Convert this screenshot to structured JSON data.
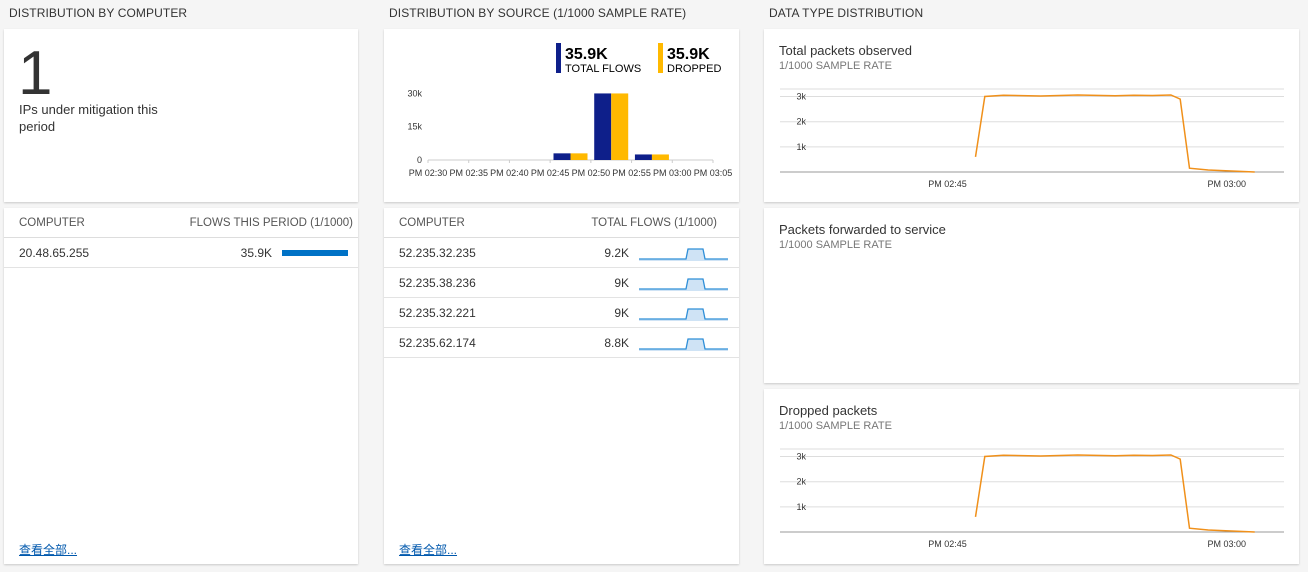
{
  "sections": {
    "computer": "DISTRIBUTION BY COMPUTER",
    "source": "DISTRIBUTION BY SOURCE (1/1000 SAMPLE RATE)",
    "datatype": "DATA TYPE DISTRIBUTION"
  },
  "mitigation": {
    "count": "1",
    "caption": "IPs under mitigation this period"
  },
  "computer_table": {
    "col1": "COMPUTER",
    "col2": "FLOWS THIS PERIOD (1/1000)",
    "rows": [
      {
        "ip": "20.48.65.255",
        "flows": "35.9K",
        "fraction": 1.0
      }
    ],
    "see_all": "查看全部..."
  },
  "source_chart": {
    "legend": [
      {
        "value": "35.9K",
        "label": "TOTAL FLOWS",
        "color": "#0e1f8a"
      },
      {
        "value": "35.9K",
        "label": "DROPPED",
        "color": "#ffb900"
      }
    ]
  },
  "source_table": {
    "col1": "COMPUTER",
    "col2": "TOTAL FLOWS (1/1000)",
    "rows": [
      {
        "ip": "52.235.32.235",
        "flows": "9.2K"
      },
      {
        "ip": "52.235.38.236",
        "flows": "9K"
      },
      {
        "ip": "52.235.32.221",
        "flows": "9K"
      },
      {
        "ip": "52.235.62.174",
        "flows": "8.8K"
      }
    ],
    "see_all": "查看全部..."
  },
  "datatype_tiles": [
    {
      "title": "Total packets observed",
      "subtitle": "1/1000 SAMPLE RATE"
    },
    {
      "title": "Packets forwarded to service",
      "subtitle": "1/1000 SAMPLE RATE"
    },
    {
      "title": "Dropped packets",
      "subtitle": "1/1000 SAMPLE RATE"
    }
  ],
  "chart_data": [
    {
      "type": "bar",
      "categories": [
        "PM 02:30",
        "PM 02:35",
        "PM 02:40",
        "PM 02:45",
        "PM 02:50",
        "PM 02:55",
        "PM 03:00",
        "PM 03:05"
      ],
      "tick_labels": [
        "PM 02:30",
        "PM 02:35",
        "PM 02:40",
        "PM 02:45",
        "PM 02:50",
        "PM 02:55",
        "PM 03:00",
        "PM 03:05"
      ],
      "series": [
        {
          "name": "TOTAL FLOWS",
          "color": "#0e1f8a",
          "values": [
            0,
            0,
            0,
            3000,
            30000,
            2500,
            0,
            0
          ]
        },
        {
          "name": "DROPPED",
          "color": "#ffb900",
          "values": [
            0,
            0,
            0,
            3000,
            30000,
            2500,
            0,
            0
          ]
        }
      ],
      "yticks": [
        "0",
        "15k",
        "30k"
      ],
      "ytick_values": [
        0,
        15000,
        30000
      ],
      "ylim": [
        0,
        32000
      ],
      "legend": "top-right"
    },
    {
      "type": "line",
      "x_minutes": [
        46.5,
        47,
        48,
        50,
        52,
        54,
        55,
        56,
        57,
        57.5,
        58,
        59,
        61.5
      ],
      "values": [
        600,
        3000,
        3050,
        3020,
        3060,
        3030,
        3050,
        3040,
        3060,
        2900,
        150,
        80,
        0
      ],
      "xticks": [
        "PM 02:45",
        "PM 03:00"
      ],
      "xtick_minutes": [
        45,
        60
      ],
      "yticks": [
        "1k",
        "2k",
        "3k"
      ],
      "ytick_values": [
        1000,
        2000,
        3000
      ],
      "ylim": [
        0,
        3300
      ],
      "xlim": [
        36,
        62
      ],
      "color": "#f0901a"
    },
    {
      "type": "line",
      "x_minutes": [
        46.5,
        47,
        48,
        50,
        52,
        54,
        55,
        56,
        57,
        57.5,
        58,
        59,
        61.5
      ],
      "values": [
        600,
        3000,
        3050,
        3020,
        3060,
        3030,
        3050,
        3040,
        3060,
        2900,
        150,
        80,
        0
      ],
      "xticks": [
        "PM 02:45",
        "PM 03:00"
      ],
      "xtick_minutes": [
        45,
        60
      ],
      "yticks": [
        "1k",
        "2k",
        "3k"
      ],
      "ytick_values": [
        1000,
        2000,
        3000
      ],
      "ylim": [
        0,
        3300
      ],
      "xlim": [
        36,
        62
      ],
      "color": "#f0901a"
    }
  ]
}
